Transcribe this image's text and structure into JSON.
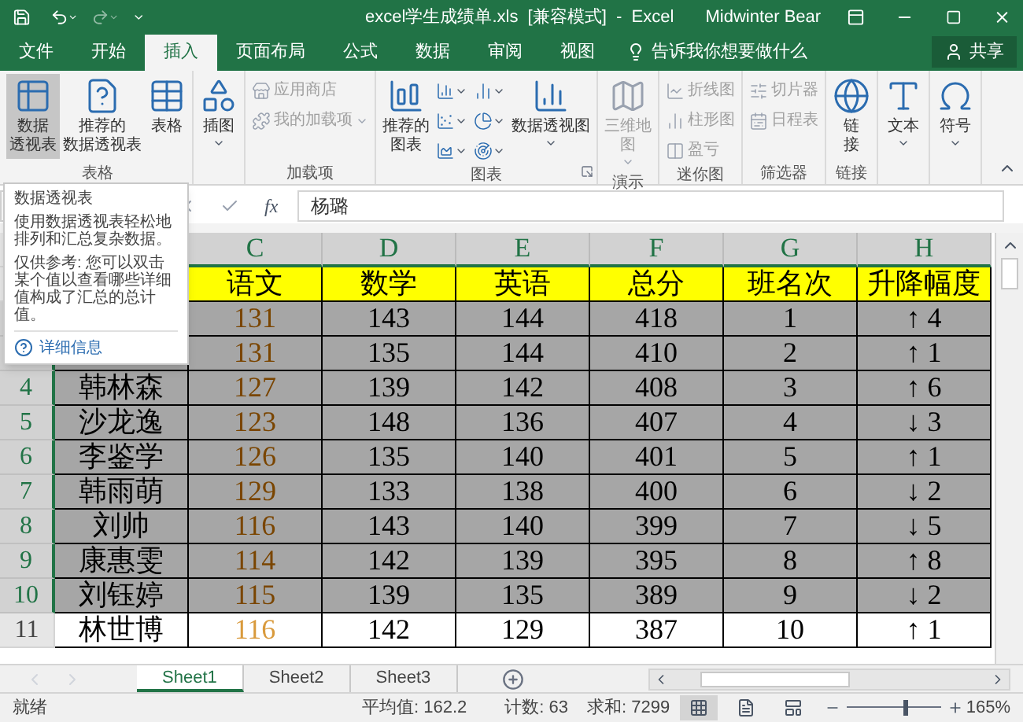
{
  "title_bar": {
    "title": "excel学生成绩单.xls  [兼容模式]  -  Excel",
    "user": "Midwinter Bear"
  },
  "tabs": [
    {
      "label": "文件",
      "selected": false
    },
    {
      "label": "开始",
      "selected": false
    },
    {
      "label": "插入",
      "selected": true
    },
    {
      "label": "页面布局",
      "selected": false
    },
    {
      "label": "公式",
      "selected": false
    },
    {
      "label": "数据",
      "selected": false
    },
    {
      "label": "审阅",
      "selected": false
    },
    {
      "label": "视图",
      "selected": false
    }
  ],
  "tell_me": "告诉我你想要做什么",
  "share": "共享",
  "ribbon": [
    {
      "label": "表格",
      "items": [
        {
          "kind": "large",
          "lines": [
            "数据",
            "透视表"
          ],
          "selected": true,
          "disabled": false,
          "dropdown": false
        },
        {
          "kind": "large",
          "lines": [
            "推荐的",
            "数据透视表"
          ],
          "selected": false,
          "disabled": false,
          "dropdown": false
        },
        {
          "kind": "large",
          "lines": [
            "表格"
          ],
          "selected": false,
          "disabled": false,
          "dropdown": false
        }
      ]
    },
    {
      "items": [
        {
          "kind": "large",
          "lines": [
            "插图"
          ],
          "selected": false,
          "disabled": false,
          "dropdown": true
        }
      ]
    },
    {
      "label": "加载项",
      "items": [
        {
          "kind": "small",
          "lines": [
            "应用商店"
          ],
          "selected": false,
          "disabled": true,
          "dropdown": false
        },
        {
          "kind": "small",
          "lines": [
            "我的加载项"
          ],
          "selected": false,
          "disabled": true,
          "dropdown": true
        }
      ]
    },
    {
      "label": "图表",
      "launcher": true,
      "items": [
        {
          "kind": "large",
          "lines": [
            "推荐的",
            "图表"
          ],
          "selected": false,
          "disabled": false,
          "dropdown": false
        },
        {
          "kind": "icon",
          "selected": false,
          "disabled": false,
          "dropdown": true
        },
        {
          "kind": "icon",
          "selected": false,
          "disabled": false,
          "dropdown": true
        },
        {
          "kind": "icon",
          "selected": false,
          "disabled": false,
          "dropdown": true
        },
        {
          "kind": "icon",
          "selected": false,
          "disabled": false,
          "dropdown": true
        },
        {
          "kind": "icon",
          "selected": false,
          "disabled": false,
          "dropdown": true
        },
        {
          "kind": "icon",
          "selected": false,
          "disabled": false,
          "dropdown": true
        },
        {
          "kind": "large",
          "lines": [
            "数据透视图"
          ],
          "selected": false,
          "disabled": false,
          "dropdown": true
        }
      ]
    },
    {
      "label": "演示",
      "items": [
        {
          "kind": "large",
          "lines": [
            "三维地",
            "图"
          ],
          "selected": false,
          "disabled": true,
          "dropdown": true
        }
      ]
    },
    {
      "label": "迷你图",
      "items": [
        {
          "kind": "small",
          "lines": [
            "折线图"
          ],
          "selected": false,
          "disabled": true,
          "dropdown": false
        },
        {
          "kind": "small",
          "lines": [
            "柱形图"
          ],
          "selected": false,
          "disabled": true,
          "dropdown": false
        },
        {
          "kind": "small",
          "lines": [
            "盈亏"
          ],
          "selected": false,
          "disabled": true,
          "dropdown": false
        }
      ]
    },
    {
      "label": "筛选器",
      "items": [
        {
          "kind": "small",
          "lines": [
            "切片器"
          ],
          "selected": false,
          "disabled": true,
          "dropdown": false
        },
        {
          "kind": "small",
          "lines": [
            "日程表"
          ],
          "selected": false,
          "disabled": true,
          "dropdown": false
        }
      ]
    },
    {
      "label": "链接",
      "items": [
        {
          "kind": "large",
          "lines": [
            "链",
            "接"
          ],
          "selected": false,
          "disabled": false,
          "dropdown": false
        }
      ]
    },
    {
      "items": [
        {
          "kind": "large",
          "lines": [
            "文本"
          ],
          "selected": false,
          "disabled": false,
          "dropdown": true
        }
      ]
    },
    {
      "items": [
        {
          "kind": "large",
          "lines": [
            "符号"
          ],
          "selected": false,
          "disabled": false,
          "dropdown": true
        }
      ]
    }
  ],
  "formula_bar": {
    "function_label": "fx",
    "value": "杨璐"
  },
  "tooltip": {
    "title": "数据透视表",
    "paragraphs": [
      "使用数据透视表轻松地排列和汇总复杂数据。",
      "仅供参考: 您可以双击某个值以查看哪些详细值构成了汇总的总计值。"
    ],
    "link": "详细信息"
  },
  "sheet": {
    "columns": [
      "C",
      "D",
      "E",
      "F",
      "G",
      "H"
    ],
    "header": [
      "语文",
      "数学",
      "英语",
      "总分",
      "班名次",
      "升降幅度"
    ],
    "rows": [
      {
        "values": [
          "131",
          "143",
          "144",
          "418",
          "1",
          "↑ 4"
        ],
        "selected": true
      },
      {
        "values": [
          "131",
          "135",
          "144",
          "410",
          "2",
          "↑ 1"
        ],
        "selected": true
      },
      {
        "number": "4",
        "name": "韩林森",
        "values": [
          "127",
          "139",
          "142",
          "408",
          "3",
          "↑ 6"
        ],
        "selected": true
      },
      {
        "number": "5",
        "name": "沙龙逸",
        "values": [
          "123",
          "148",
          "136",
          "407",
          "4",
          "↓ 3"
        ],
        "selected": true
      },
      {
        "number": "6",
        "name": "李鉴学",
        "values": [
          "126",
          "135",
          "140",
          "401",
          "5",
          "↑ 1"
        ],
        "selected": true
      },
      {
        "number": "7",
        "name": "韩雨萌",
        "values": [
          "129",
          "133",
          "138",
          "400",
          "6",
          "↓ 2"
        ],
        "selected": true
      },
      {
        "number": "8",
        "name": "刘帅",
        "values": [
          "116",
          "143",
          "140",
          "399",
          "7",
          "↓ 5"
        ],
        "selected": true
      },
      {
        "number": "9",
        "name": "康惠雯",
        "values": [
          "114",
          "142",
          "139",
          "395",
          "8",
          "↑ 8"
        ],
        "selected": true
      },
      {
        "number": "10",
        "name": "刘钰婷",
        "values": [
          "115",
          "139",
          "135",
          "389",
          "9",
          "↓ 2"
        ],
        "selected": true
      },
      {
        "number": "11",
        "name": "林世博",
        "values": [
          "116",
          "142",
          "129",
          "387",
          "10",
          "↑ 1"
        ],
        "selected": false
      }
    ]
  },
  "sheet_tabs": [
    {
      "label": "Sheet1",
      "selected": true
    },
    {
      "label": "Sheet2",
      "selected": false
    },
    {
      "label": "Sheet3",
      "selected": false
    }
  ],
  "status_bar": {
    "status": "就绪",
    "average": "平均值: 162.2",
    "count": "计数: 63",
    "sum": "求和: 7299",
    "views": [
      {
        "selected": true
      },
      {
        "selected": false
      },
      {
        "selected": false
      }
    ],
    "zoom_slider": {
      "level": 0.6
    },
    "zoom": "165%"
  }
}
